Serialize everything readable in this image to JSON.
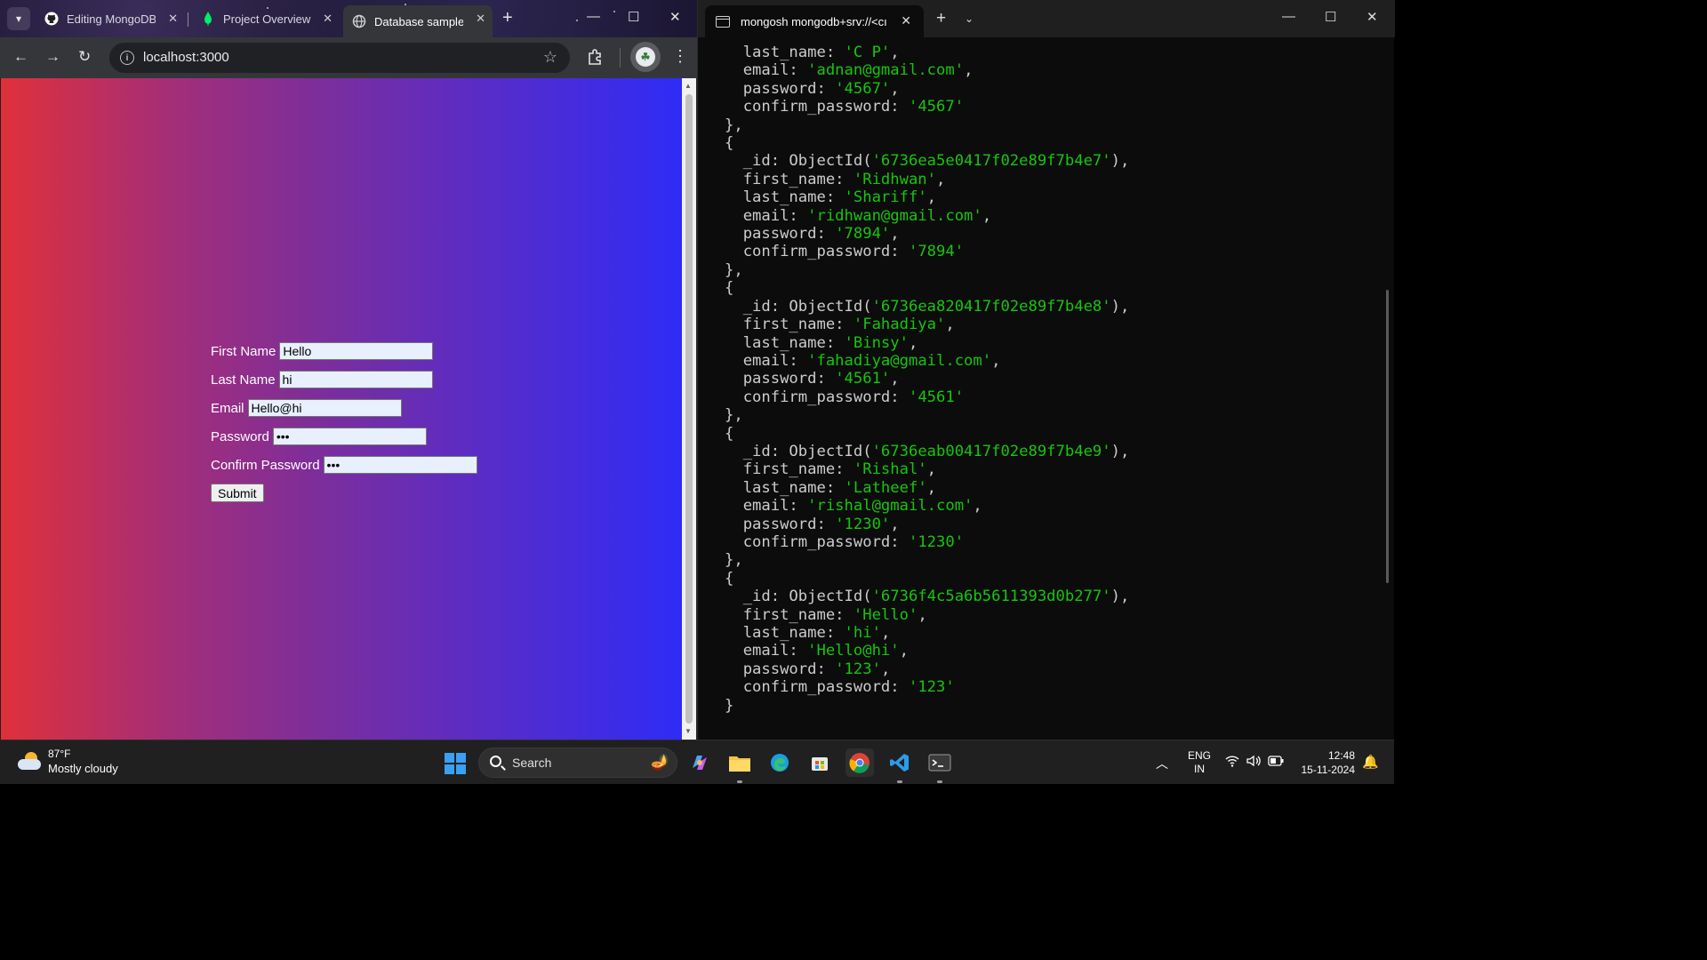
{
  "browser": {
    "tabs": [
      {
        "title": "Editing MongoDB-",
        "icon": "github-icon"
      },
      {
        "title": "Project Overview |",
        "icon": "mongodb-leaf-icon"
      },
      {
        "title": "Database sample",
        "icon": "globe-icon",
        "active": true
      }
    ],
    "address": "localhost:3000",
    "page": {
      "fields": [
        {
          "label": "First Name",
          "value": "Hello"
        },
        {
          "label": "Last Name",
          "value": "hi"
        },
        {
          "label": "Email",
          "value": "Hello@hi"
        },
        {
          "label": "Password",
          "value": "•••"
        },
        {
          "label": "Confirm Password",
          "value": "•••"
        }
      ],
      "submit_label": "Submit"
    }
  },
  "terminal": {
    "tab_title": "mongosh mongodb+srv://<cı",
    "lines": [
      [
        {
          "t": "  last_name: "
        },
        {
          "t": "'C P'",
          "s": 1
        },
        {
          "t": ","
        }
      ],
      [
        {
          "t": "  email: "
        },
        {
          "t": "'adnan@gmail.com'",
          "s": 1
        },
        {
          "t": ","
        }
      ],
      [
        {
          "t": "  password: "
        },
        {
          "t": "'4567'",
          "s": 1
        },
        {
          "t": ","
        }
      ],
      [
        {
          "t": "  confirm_password: "
        },
        {
          "t": "'4567'",
          "s": 1
        }
      ],
      [
        {
          "t": "},"
        }
      ],
      [
        {
          "t": "{"
        }
      ],
      [
        {
          "t": "  _id: ObjectId("
        },
        {
          "t": "'6736ea5e0417f02e89f7b4e7'",
          "s": 1
        },
        {
          "t": "),"
        }
      ],
      [
        {
          "t": "  first_name: "
        },
        {
          "t": "'Ridhwan'",
          "s": 1
        },
        {
          "t": ","
        }
      ],
      [
        {
          "t": "  last_name: "
        },
        {
          "t": "'Shariff'",
          "s": 1
        },
        {
          "t": ","
        }
      ],
      [
        {
          "t": "  email: "
        },
        {
          "t": "'ridhwan@gmail.com'",
          "s": 1
        },
        {
          "t": ","
        }
      ],
      [
        {
          "t": "  password: "
        },
        {
          "t": "'7894'",
          "s": 1
        },
        {
          "t": ","
        }
      ],
      [
        {
          "t": "  confirm_password: "
        },
        {
          "t": "'7894'",
          "s": 1
        }
      ],
      [
        {
          "t": "},"
        }
      ],
      [
        {
          "t": "{"
        }
      ],
      [
        {
          "t": "  _id: ObjectId("
        },
        {
          "t": "'6736ea820417f02e89f7b4e8'",
          "s": 1
        },
        {
          "t": "),"
        }
      ],
      [
        {
          "t": "  first_name: "
        },
        {
          "t": "'Fahadiya'",
          "s": 1
        },
        {
          "t": ","
        }
      ],
      [
        {
          "t": "  last_name: "
        },
        {
          "t": "'Binsy'",
          "s": 1
        },
        {
          "t": ","
        }
      ],
      [
        {
          "t": "  email: "
        },
        {
          "t": "'fahadiya@gmail.com'",
          "s": 1
        },
        {
          "t": ","
        }
      ],
      [
        {
          "t": "  password: "
        },
        {
          "t": "'4561'",
          "s": 1
        },
        {
          "t": ","
        }
      ],
      [
        {
          "t": "  confirm_password: "
        },
        {
          "t": "'4561'",
          "s": 1
        }
      ],
      [
        {
          "t": "},"
        }
      ],
      [
        {
          "t": "{"
        }
      ],
      [
        {
          "t": "  _id: ObjectId("
        },
        {
          "t": "'6736eab00417f02e89f7b4e9'",
          "s": 1
        },
        {
          "t": "),"
        }
      ],
      [
        {
          "t": "  first_name: "
        },
        {
          "t": "'Rishal'",
          "s": 1
        },
        {
          "t": ","
        }
      ],
      [
        {
          "t": "  last_name: "
        },
        {
          "t": "'Latheef'",
          "s": 1
        },
        {
          "t": ","
        }
      ],
      [
        {
          "t": "  email: "
        },
        {
          "t": "'rishal@gmail.com'",
          "s": 1
        },
        {
          "t": ","
        }
      ],
      [
        {
          "t": "  password: "
        },
        {
          "t": "'1230'",
          "s": 1
        },
        {
          "t": ","
        }
      ],
      [
        {
          "t": "  confirm_password: "
        },
        {
          "t": "'1230'",
          "s": 1
        }
      ],
      [
        {
          "t": "},"
        }
      ],
      [
        {
          "t": "{"
        }
      ],
      [
        {
          "t": "  _id: ObjectId("
        },
        {
          "t": "'6736f4c5a6b5611393d0b277'",
          "s": 1
        },
        {
          "t": "),"
        }
      ],
      [
        {
          "t": "  first_name: "
        },
        {
          "t": "'Hello'",
          "s": 1
        },
        {
          "t": ","
        }
      ],
      [
        {
          "t": "  last_name: "
        },
        {
          "t": "'hi'",
          "s": 1
        },
        {
          "t": ","
        }
      ],
      [
        {
          "t": "  email: "
        },
        {
          "t": "'Hello@hi'",
          "s": 1
        },
        {
          "t": ","
        }
      ],
      [
        {
          "t": "  password: "
        },
        {
          "t": "'123'",
          "s": 1
        },
        {
          "t": ","
        }
      ],
      [
        {
          "t": "  confirm_password: "
        },
        {
          "t": "'123'",
          "s": 1
        }
      ],
      [
        {
          "t": "}"
        }
      ]
    ]
  },
  "taskbar": {
    "weather_temp": "87°F",
    "weather_desc": "Mostly cloudy",
    "search_label": "Search",
    "lang_line1": "ENG",
    "lang_line2": "IN",
    "time": "12:48",
    "date": "15-11-2024"
  },
  "colors": {
    "terminal_string": "#16c60c",
    "page_gradient_start": "#e0303a",
    "page_gradient_end": "#2f2cf6"
  }
}
